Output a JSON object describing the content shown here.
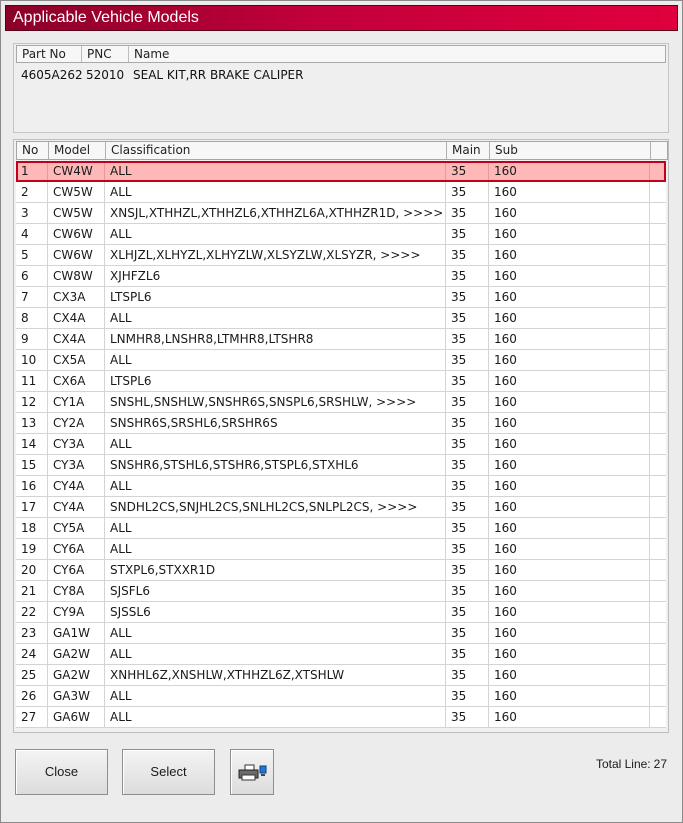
{
  "window": {
    "title": "Applicable Vehicle Models"
  },
  "part_info": {
    "headers": [
      "Part No",
      "PNC",
      "Name"
    ],
    "part_no": "4605A262",
    "pnc": "52010",
    "name": "SEAL KIT,RR BRAKE CALIPER"
  },
  "grid": {
    "headers": [
      "No",
      "Model",
      "Classification",
      "Main",
      "Sub"
    ],
    "selected_index": 0,
    "rows": [
      [
        "1",
        "CW4W",
        "ALL",
        "35",
        "160"
      ],
      [
        "2",
        "CW5W",
        "ALL",
        "35",
        "160"
      ],
      [
        "3",
        "CW5W",
        "XNSJL,XTHHZL,XTHHZL6,XTHHZL6A,XTHHZR1D,  >>>>",
        "35",
        "160"
      ],
      [
        "4",
        "CW6W",
        "ALL",
        "35",
        "160"
      ],
      [
        "5",
        "CW6W",
        "XLHJZL,XLHYZL,XLHYZLW,XLSYZLW,XLSYZR,  >>>>",
        "35",
        "160"
      ],
      [
        "6",
        "CW8W",
        "XJHFZL6",
        "35",
        "160"
      ],
      [
        "7",
        "CX3A",
        "LTSPL6",
        "35",
        "160"
      ],
      [
        "8",
        "CX4A",
        "ALL",
        "35",
        "160"
      ],
      [
        "9",
        "CX4A",
        "LNMHR8,LNSHR8,LTMHR8,LTSHR8",
        "35",
        "160"
      ],
      [
        "10",
        "CX5A",
        "ALL",
        "35",
        "160"
      ],
      [
        "11",
        "CX6A",
        "LTSPL6",
        "35",
        "160"
      ],
      [
        "12",
        "CY1A",
        "SNSHL,SNSHLW,SNSHR6S,SNSPL6,SRSHLW,  >>>>",
        "35",
        "160"
      ],
      [
        "13",
        "CY2A",
        "SNSHR6S,SRSHL6,SRSHR6S",
        "35",
        "160"
      ],
      [
        "14",
        "CY3A",
        "ALL",
        "35",
        "160"
      ],
      [
        "15",
        "CY3A",
        "SNSHR6,STSHL6,STSHR6,STSPL6,STXHL6",
        "35",
        "160"
      ],
      [
        "16",
        "CY4A",
        "ALL",
        "35",
        "160"
      ],
      [
        "17",
        "CY4A",
        "SNDHL2CS,SNJHL2CS,SNLHL2CS,SNLPL2CS,  >>>>",
        "35",
        "160"
      ],
      [
        "18",
        "CY5A",
        "ALL",
        "35",
        "160"
      ],
      [
        "19",
        "CY6A",
        "ALL",
        "35",
        "160"
      ],
      [
        "20",
        "CY6A",
        "STXPL6,STXXR1D",
        "35",
        "160"
      ],
      [
        "21",
        "CY8A",
        "SJSFL6",
        "35",
        "160"
      ],
      [
        "22",
        "CY9A",
        "SJSSL6",
        "35",
        "160"
      ],
      [
        "23",
        "GA1W",
        "ALL",
        "35",
        "160"
      ],
      [
        "24",
        "GA2W",
        "ALL",
        "35",
        "160"
      ],
      [
        "25",
        "GA2W",
        "XNHHL6Z,XNSHLW,XTHHZL6Z,XTSHLW",
        "35",
        "160"
      ],
      [
        "26",
        "GA3W",
        "ALL",
        "35",
        "160"
      ],
      [
        "27",
        "GA6W",
        "ALL",
        "35",
        "160"
      ]
    ]
  },
  "buttons": {
    "close": "Close",
    "select": "Select",
    "print_icon": "printer-icon"
  },
  "footer": {
    "total_label": "Total Line:",
    "total_value": "27"
  },
  "colors": {
    "title_bar": "#c1003a",
    "selected_row": "#ffb8b8",
    "selected_border": "#c2001c"
  }
}
